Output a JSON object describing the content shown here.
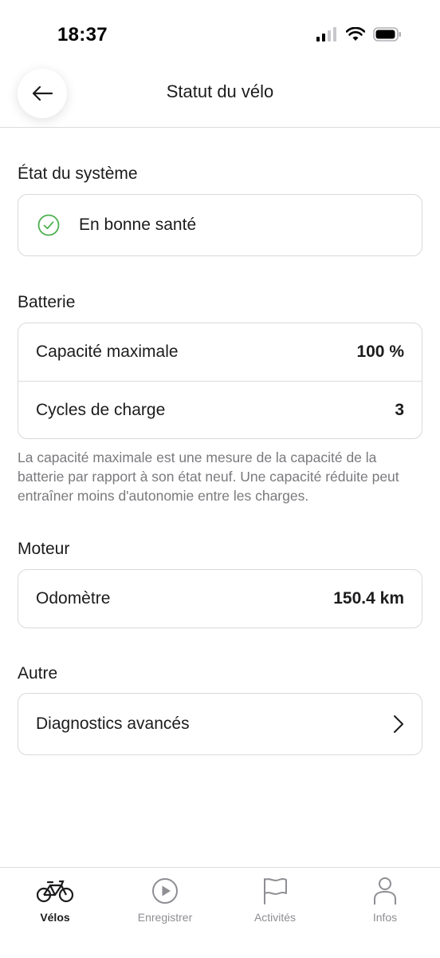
{
  "status_bar": {
    "time": "18:37"
  },
  "nav": {
    "title": "Statut du vélo"
  },
  "system": {
    "section_title": "État du système",
    "status_label": "En bonne santé"
  },
  "battery": {
    "section_title": "Batterie",
    "rows": [
      {
        "label": "Capacité maximale",
        "value": "100 %"
      },
      {
        "label": "Cycles de charge",
        "value": "3"
      }
    ],
    "note": "La capacité maximale est une mesure de la capacité de la batterie par rapport à son état neuf. Une capacité réduite peut entraîner moins d'autonomie entre les charges."
  },
  "motor": {
    "section_title": "Moteur",
    "rows": [
      {
        "label": "Odomètre",
        "value": "150.4 km"
      }
    ]
  },
  "other": {
    "section_title": "Autre",
    "rows": [
      {
        "label": "Diagnostics avancés",
        "icon": "chevron-right-icon"
      }
    ]
  },
  "tabs": [
    {
      "label": "Vélos",
      "icon": "bike-icon",
      "active": true
    },
    {
      "label": "Enregistrer",
      "icon": "play-circle-icon",
      "active": false
    },
    {
      "label": "Activités",
      "icon": "flag-icon",
      "active": false
    },
    {
      "label": "Infos",
      "icon": "person-icon",
      "active": false
    }
  ],
  "colors": {
    "success": "#4cb04e",
    "muted": "#8e8e93"
  }
}
